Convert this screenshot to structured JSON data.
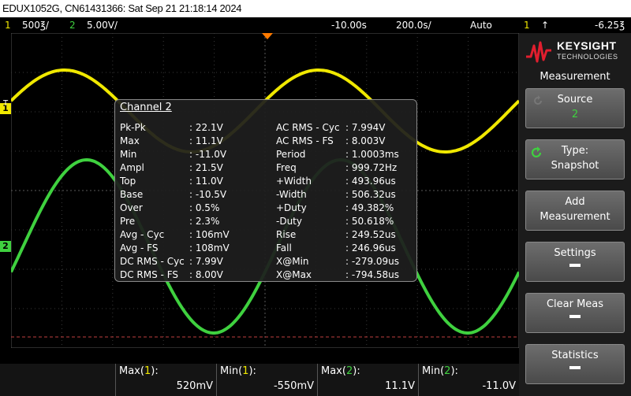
{
  "title": "EDUX1052G, CN61431366: Sat Sep 21 21:18:14 2024",
  "status": {
    "ch1_num": "1",
    "ch1_scale": "500℥/",
    "ch2_num": "2",
    "ch2_scale": "5.00V/",
    "delay": "-10.00s",
    "timebase": "200.0s/",
    "trigger_mode": "Auto",
    "trigger_ch": "1",
    "trigger_level": "-6.25℥"
  },
  "status_display": {
    "ch1_scale": "500̄/",
    "delay": "-10.00̄",
    "timebase": "200.0̄/",
    "trigger_level": "-6.25̄"
  },
  "brand": {
    "name": "KEYSIGHT",
    "sub": "TECHNOLOGIES"
  },
  "menu": {
    "title": "Measurement",
    "source_label": "Source",
    "source_value": "2",
    "type_label": "Type:",
    "type_value": "Snapshot",
    "add_line1": "Add",
    "add_line2": "Measurement",
    "settings": "Settings",
    "clear": "Clear Meas",
    "statistics": "Statistics"
  },
  "markers": {
    "ch1": "1",
    "ch2": "2",
    "trig": "T"
  },
  "colors": {
    "ch1": "#f0e800",
    "ch2": "#3fd13f",
    "grid": "#3a3a3a",
    "trigger_marker": "#ff7a00"
  },
  "measure": {
    "title": "Channel 2",
    "left": [
      {
        "label": "Pk-Pk",
        "value": ": 22.1V"
      },
      {
        "label": "Max",
        "value": ": 11.1V"
      },
      {
        "label": "Min",
        "value": ": -11.0V"
      },
      {
        "label": "Ampl",
        "value": ": 21.5V"
      },
      {
        "label": "Top",
        "value": ": 11.0V"
      },
      {
        "label": "Base",
        "value": ": -10.5V"
      },
      {
        "label": "Over",
        "value": ": 0.5%"
      },
      {
        "label": "Pre",
        "value": ": 2.3%"
      },
      {
        "label": "Avg - Cyc",
        "value": ": 106mV"
      },
      {
        "label": "Avg - FS",
        "value": ": 108mV"
      },
      {
        "label": "DC RMS - Cyc",
        "value": ": 7.99V"
      },
      {
        "label": "DC RMS - FS",
        "value": ": 8.00V"
      }
    ],
    "right": [
      {
        "label": "AC RMS - Cyc",
        "value": ": 7.994V"
      },
      {
        "label": "AC RMS - FS",
        "value": ": 8.003V"
      },
      {
        "label": "Period",
        "value": ": 1.0003ms"
      },
      {
        "label": "Freq",
        "value": ": 999.72Hz"
      },
      {
        "label": "+Width",
        "value": ": 493.96us"
      },
      {
        "label": "-Width",
        "value": ": 506.32us"
      },
      {
        "label": "+Duty",
        "value": ": 49.382%"
      },
      {
        "label": "-Duty",
        "value": ": 50.618%"
      },
      {
        "label": "Rise",
        "value": ": 249.52us"
      },
      {
        "label": "Fall",
        "value": ": 246.96us"
      },
      {
        "label": "X@Min",
        "value": ": -279.09us"
      },
      {
        "label": "X@Max",
        "value": ": -794.58us"
      }
    ]
  },
  "bottom": [
    {
      "name": "Max",
      "ch": "1",
      "value": "520mV"
    },
    {
      "name": "Min",
      "ch": "1",
      "value": "-550mV"
    },
    {
      "name": "Max",
      "ch": "2",
      "value": "11.1V"
    },
    {
      "name": "Min",
      "ch": "2",
      "value": "-11.0V"
    }
  ]
}
